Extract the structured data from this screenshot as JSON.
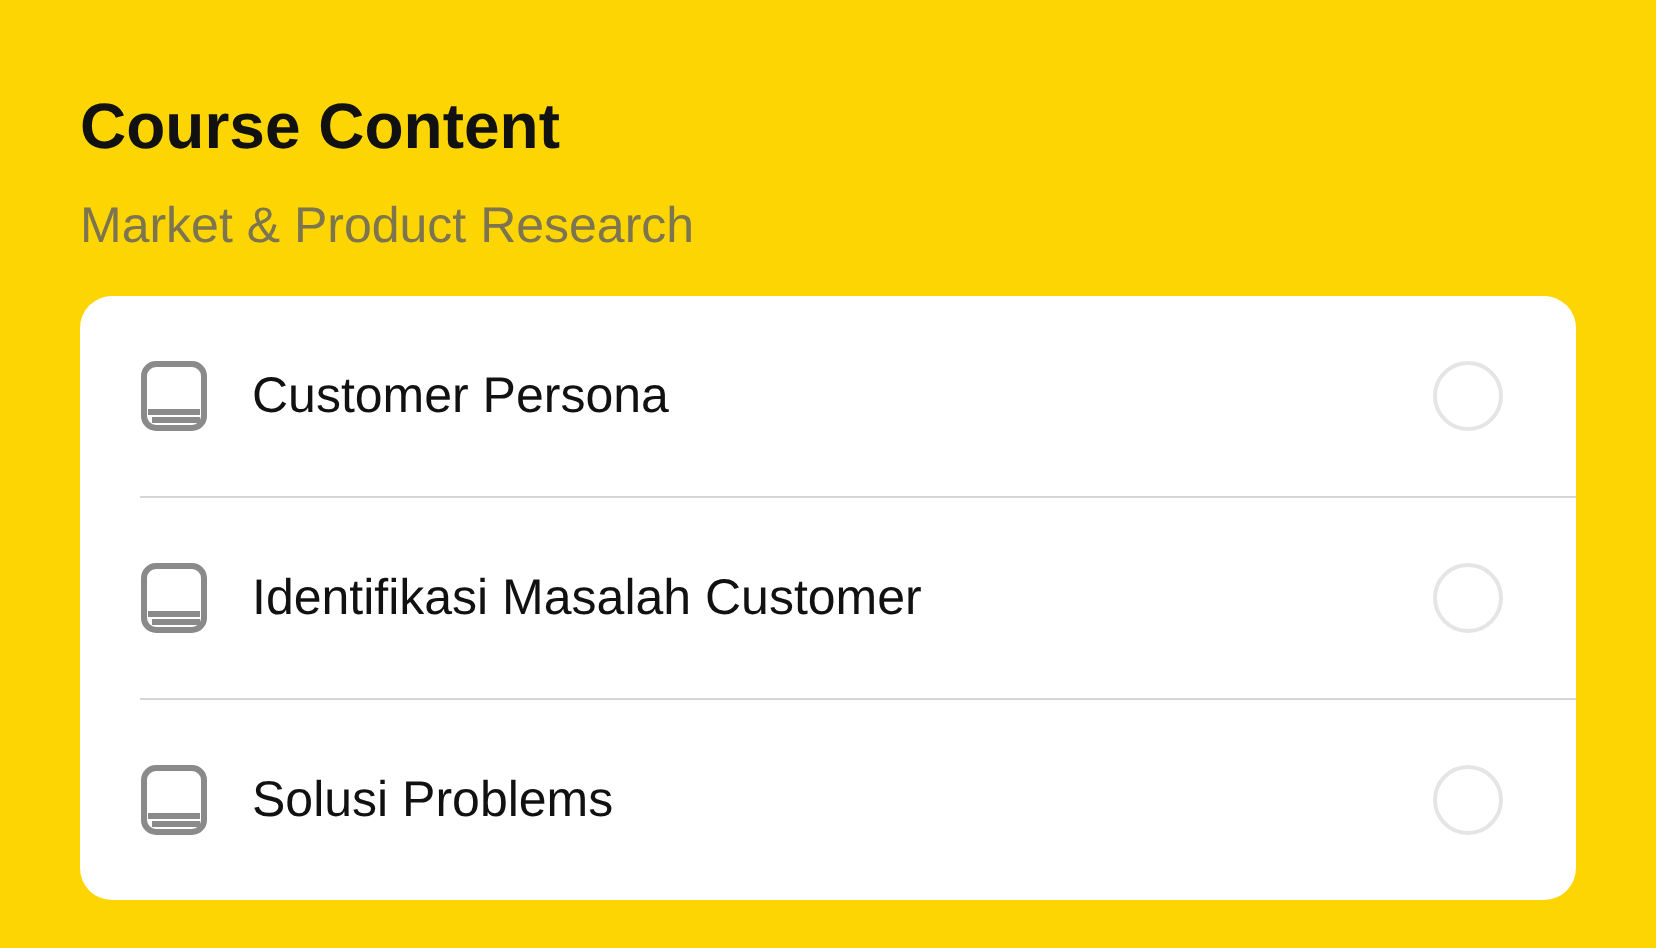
{
  "title": "Course Content",
  "section": "Market & Product Research",
  "lessons": [
    {
      "title": "Customer Persona",
      "completed": false
    },
    {
      "title": "Identifikasi Masalah Customer",
      "completed": false
    },
    {
      "title": "Solusi Problems",
      "completed": false
    }
  ]
}
